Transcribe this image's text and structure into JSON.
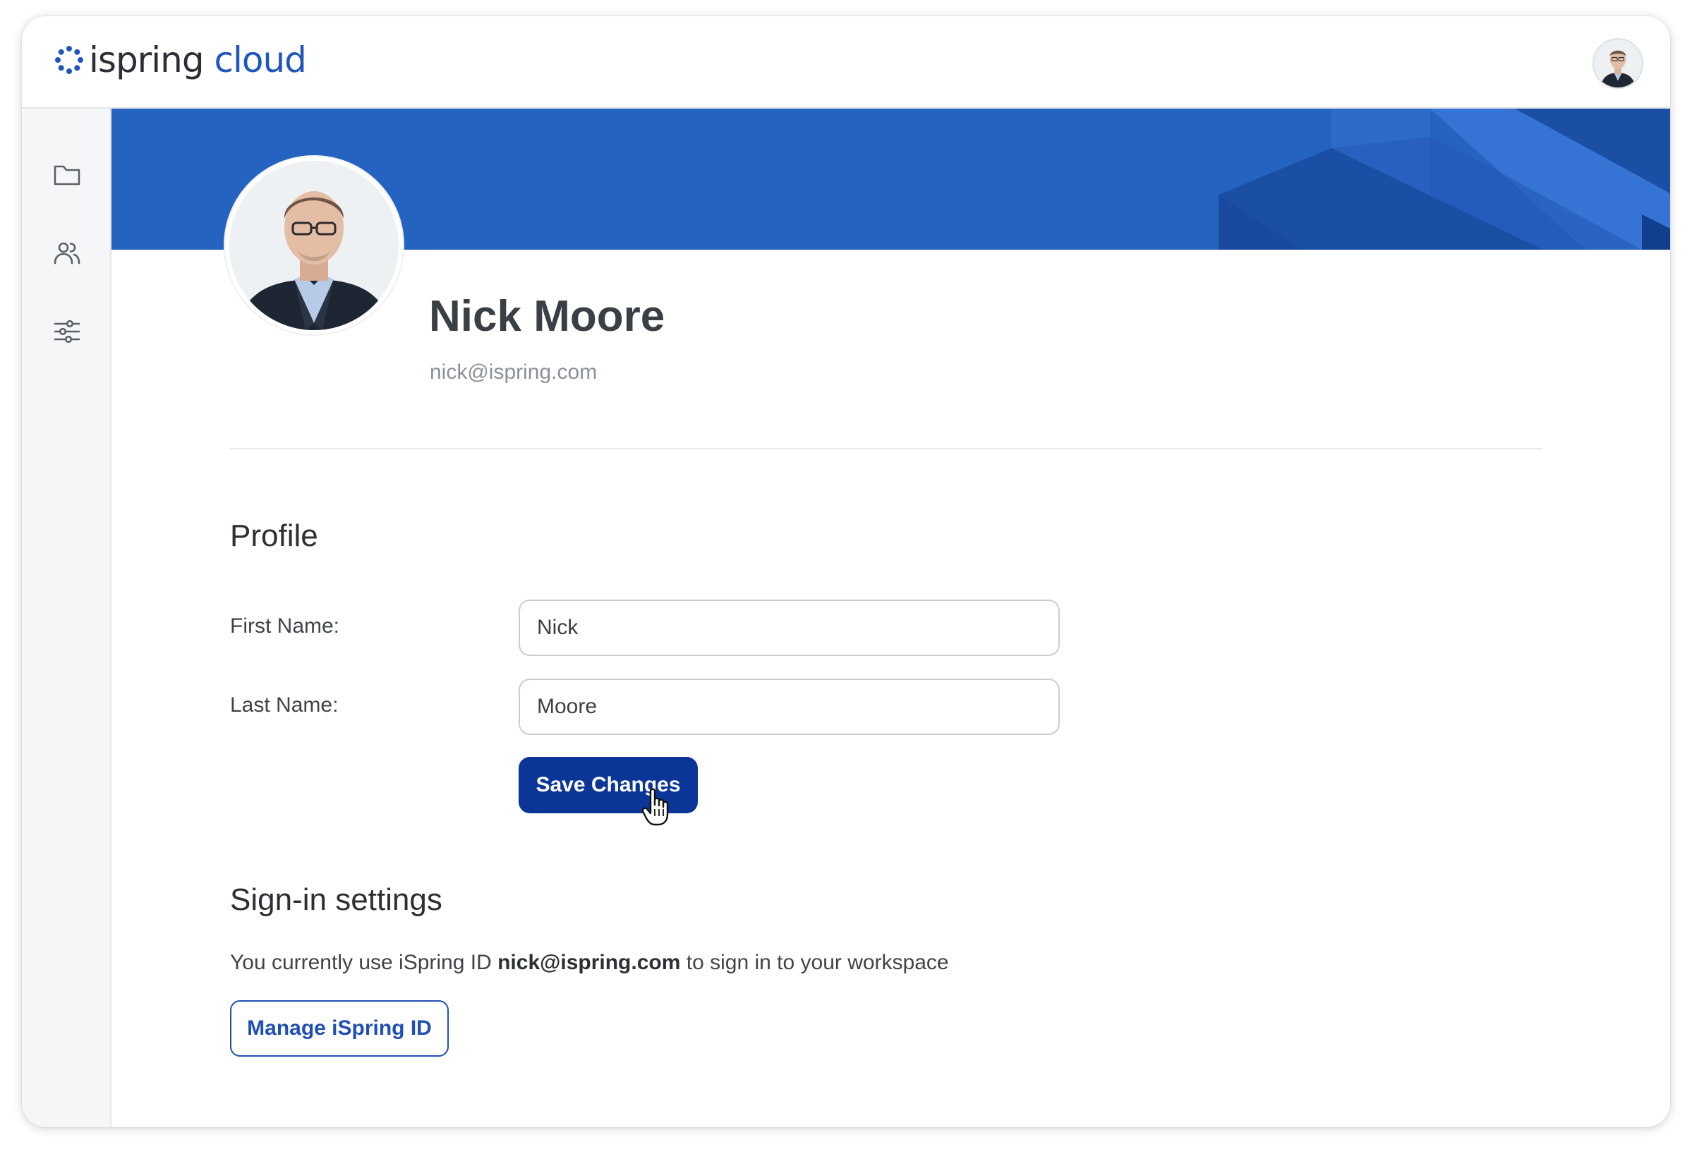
{
  "app": {
    "logo_text_part1": "ispring",
    "logo_text_part2": "cloud",
    "brand_color": "#1f56bd",
    "accent_dark": "#0b3597"
  },
  "header": {
    "avatar_icon": "user-avatar"
  },
  "sidebar": {
    "items": [
      {
        "icon": "folder-icon"
      },
      {
        "icon": "users-icon"
      },
      {
        "icon": "sliders-icon"
      }
    ]
  },
  "user": {
    "name": "Nick Moore",
    "email": "nick@ispring.com"
  },
  "profile": {
    "title": "Profile",
    "first_name_label": "First Name:",
    "first_name_value": "Nick",
    "last_name_label": "Last Name:",
    "last_name_value": "Moore",
    "save_label": "Save Changes"
  },
  "signin": {
    "title": "Sign-in settings",
    "text_before": "You currently use iSpring ID ",
    "email": "nick@ispring.com",
    "text_after": " to sign in to your workspace",
    "manage_label": "Manage iSpring ID"
  }
}
